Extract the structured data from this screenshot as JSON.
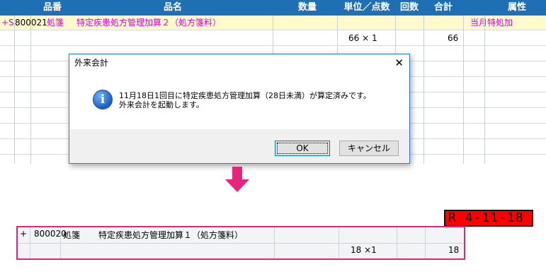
{
  "grid": {
    "headers": {
      "code": "品番",
      "name": "品名",
      "qty": "数量",
      "unit": "単位／点数",
      "count": "回数",
      "total": "合計",
      "attr": "属性"
    },
    "row1": {
      "flag": "+S",
      "code": "800021",
      "kind": "処箋",
      "name": "特定疾患処方管理加算２（処方箋料）",
      "attr": "当月特処加"
    },
    "row2": {
      "points": "66 × 1",
      "total": "66"
    }
  },
  "dialog": {
    "title": "外来会計",
    "close": "✕",
    "icon": "i",
    "message_line1": "11月18日1回目に特定疾患処方管理加算（28日未満）が算定済みです。",
    "message_line2": "外来会計を起動します。",
    "ok_label": "OK",
    "cancel_label": "キャンセル"
  },
  "date_badge": "R 4-11-18",
  "bottom": {
    "row1": {
      "flag": "+",
      "code": "800020",
      "kind": "処箋",
      "name": "特定疾患処方管理加算１（処方箋料）"
    },
    "row2": {
      "points": "18 ×1",
      "total": "18"
    }
  },
  "colors": {
    "header_bg": "#1f6fb5",
    "highlight_row": "#fffacd",
    "magenta_text": "#e000e0",
    "arrow": "#e8247a",
    "badge_bg": "#ff0000"
  }
}
